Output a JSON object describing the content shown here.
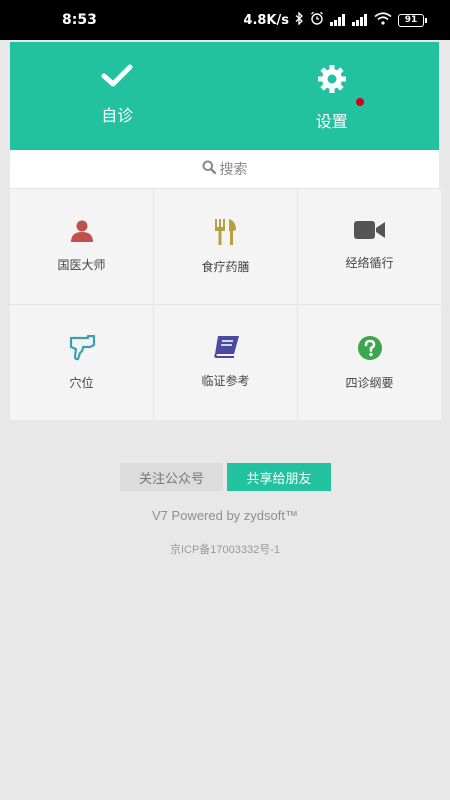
{
  "status_bar": {
    "time": "8:53",
    "network_speed": "4.8K/s",
    "battery": "91",
    "icons": [
      "bluetooth-icon",
      "alarm-icon",
      "signal-icon",
      "signal-icon",
      "wifi-icon",
      "battery-icon"
    ]
  },
  "top_panel": {
    "accent_color": "#22c19f",
    "items": [
      {
        "label": "自诊",
        "icon": "check-icon"
      },
      {
        "label": "设置",
        "icon": "gear-icon",
        "has_notification_dot": true
      }
    ]
  },
  "search": {
    "label": "搜索",
    "icon": "search-icon"
  },
  "grid": {
    "items": [
      {
        "label": "国医大师",
        "icon": "person-icon",
        "color": "#c0504d"
      },
      {
        "label": "食疗药膳",
        "icon": "utensils-icon",
        "color": "#b5a23a"
      },
      {
        "label": "经络循行",
        "icon": "video-camera-icon",
        "color": "#555555"
      },
      {
        "label": "穴位",
        "icon": "hand-pointer-icon",
        "color": "#3a9fb5"
      },
      {
        "label": "临证参考",
        "icon": "book-icon",
        "color": "#4a4aa0"
      },
      {
        "label": "四诊纲要",
        "icon": "question-circle-icon",
        "color": "#3aa74a"
      }
    ]
  },
  "footer": {
    "follow_label": "关注公众号",
    "share_label": "共享给朋友",
    "powered_by": "V7 Powered by zydsoft™",
    "icp": "京ICP备17003332号-1"
  }
}
